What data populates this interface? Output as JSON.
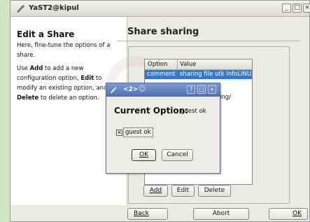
{
  "window": {
    "title": "YaST2@kipul",
    "btn_min": "_",
    "btn_max": "□",
    "btn_close": "×"
  },
  "help": {
    "title": "Edit a Share",
    "intro": "Here, fine-tune the options of a share.",
    "use_pre": "Use ",
    "add_kw": "Add",
    "use_mid1": " to add a new configuration option, ",
    "edit_kw": "Edit",
    "use_mid2": " to modify an existing option, and ",
    "delete_kw": "Delete",
    "use_post": " to delete an option."
  },
  "main": {
    "title": "Share sharing",
    "table": {
      "headers": [
        "Option",
        "Value"
      ],
      "rows": [
        {
          "option": "comment",
          "value": "sharing file utk InfoLINUX",
          "selected": true
        }
      ],
      "partial_visible_text": "ing/"
    },
    "buttons": {
      "add": "Add",
      "edit": "Edit",
      "delete": "Delete"
    }
  },
  "footer": {
    "back": "Back",
    "abort": "Abort",
    "ok": "OK"
  },
  "dialog": {
    "title": "<2>",
    "help_btn": "?",
    "max_btn": "□",
    "close_btn": "×",
    "label": "Current Option:",
    "value": "guest ok",
    "checkbox": {
      "label": "guest ok",
      "checked": true,
      "mark": "✕"
    },
    "ok": "OK",
    "cancel": "Cancel"
  },
  "colors": {
    "desktop": "#cfe6c3",
    "selection": "#3a78c6",
    "dialog_title": "#5a78b8"
  }
}
